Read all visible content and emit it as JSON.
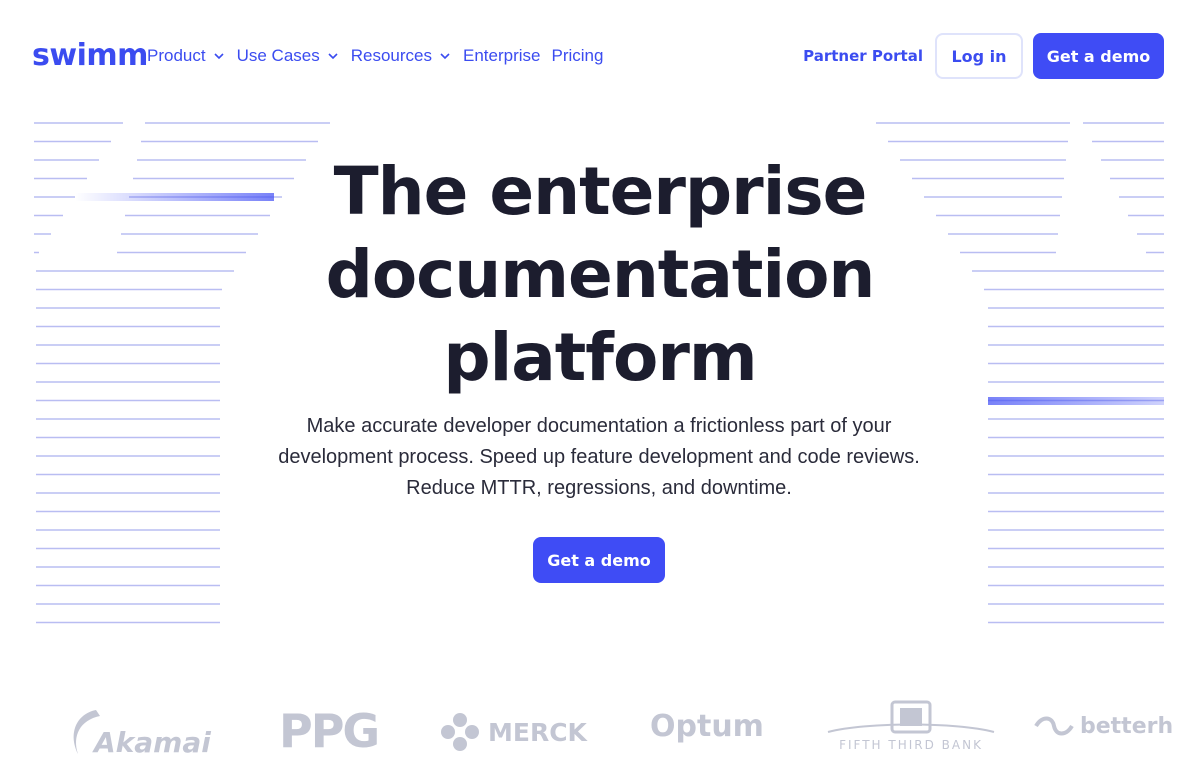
{
  "nav": {
    "logo_text": "swimm",
    "links": [
      {
        "label": "Product",
        "dropdown": true
      },
      {
        "label": "Use Cases",
        "dropdown": true
      },
      {
        "label": "Resources",
        "dropdown": true
      },
      {
        "label": "Enterprise",
        "dropdown": false
      },
      {
        "label": "Pricing",
        "dropdown": false
      }
    ],
    "partner_portal": "Partner Portal",
    "login": "Log in",
    "demo": "Get a demo"
  },
  "hero": {
    "title_line1": "The enterprise",
    "title_line2": "documentation",
    "title_line3": "platform",
    "subtitle": "Make accurate developer documentation a frictionless part of your development process. Speed up feature development and code reviews. Reduce MTTR, regressions, and downtime.",
    "cta": "Get a demo"
  },
  "clients": {
    "akamai": "Akamai",
    "ppg": "PPG",
    "merck": "MERCK",
    "optum": "Optum",
    "fifth_third": "FIFTH THIRD BANK",
    "betterh": "betterh"
  },
  "colors": {
    "brand": "#3f4cf5",
    "link": "#3b4cf0",
    "title": "#1c1d2e",
    "logo_gray": "#c3c6d3"
  }
}
